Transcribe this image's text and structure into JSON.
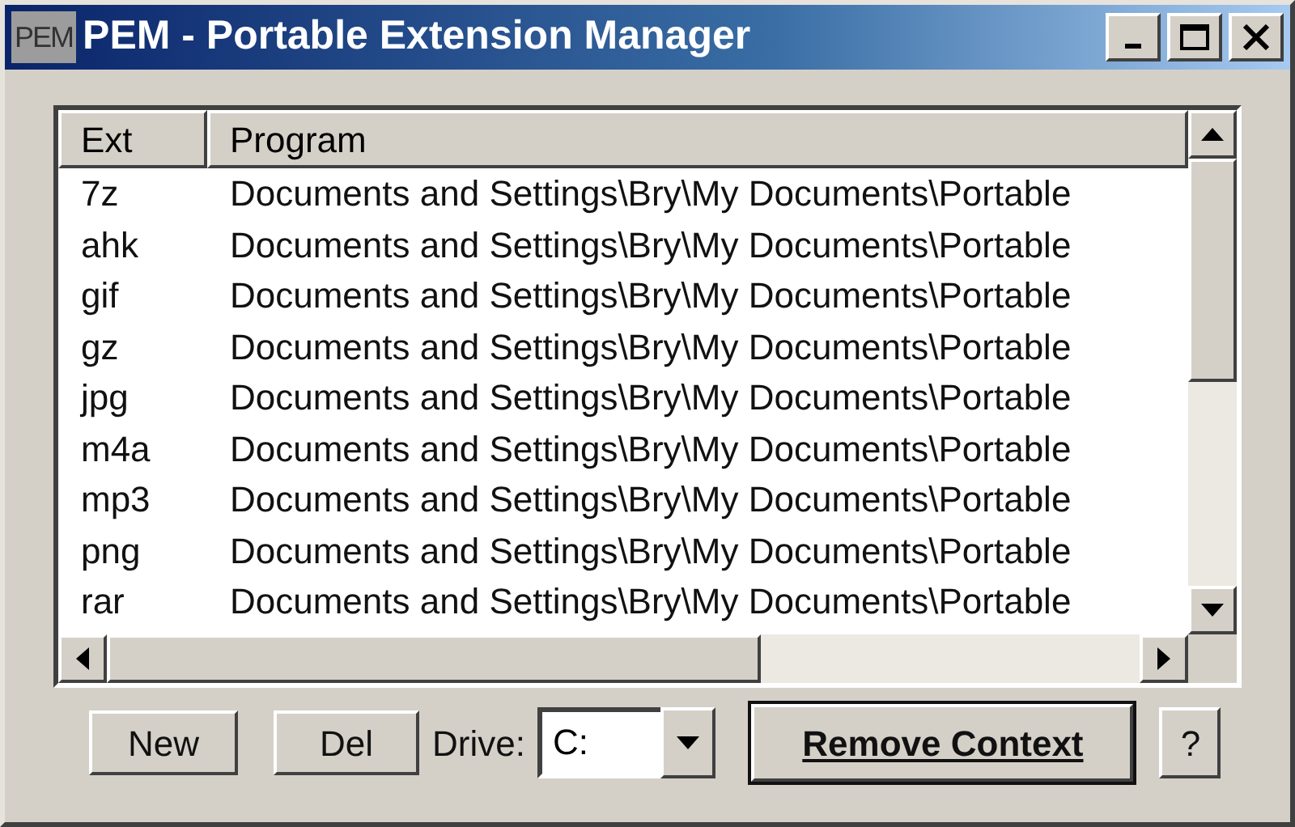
{
  "window": {
    "icon_text": "PEM",
    "title": "PEM - Portable Extension Manager"
  },
  "table": {
    "columns": [
      "Ext",
      "Program"
    ],
    "rows": [
      {
        "ext": "7z",
        "program": "Documents and Settings\\Bry\\My Documents\\Portable"
      },
      {
        "ext": "ahk",
        "program": "Documents and Settings\\Bry\\My Documents\\Portable"
      },
      {
        "ext": "gif",
        "program": "Documents and Settings\\Bry\\My Documents\\Portable"
      },
      {
        "ext": "gz",
        "program": "Documents and Settings\\Bry\\My Documents\\Portable"
      },
      {
        "ext": "jpg",
        "program": "Documents and Settings\\Bry\\My Documents\\Portable"
      },
      {
        "ext": "m4a",
        "program": "Documents and Settings\\Bry\\My Documents\\Portable"
      },
      {
        "ext": "mp3",
        "program": "Documents and Settings\\Bry\\My Documents\\Portable"
      },
      {
        "ext": "png",
        "program": "Documents and Settings\\Bry\\My Documents\\Portable"
      },
      {
        "ext": "rar",
        "program": "Documents and Settings\\Bry\\My Documents\\Portable"
      }
    ]
  },
  "buttons": [
    {
      "label": "New",
      "default": false
    },
    {
      "label": "Del",
      "default": false
    }
  ],
  "drive": {
    "label": "Drive:",
    "value": "C:"
  },
  "buttons_right": [
    {
      "label": "Remove Context",
      "default": true
    },
    {
      "label": "?",
      "default": false
    }
  ]
}
